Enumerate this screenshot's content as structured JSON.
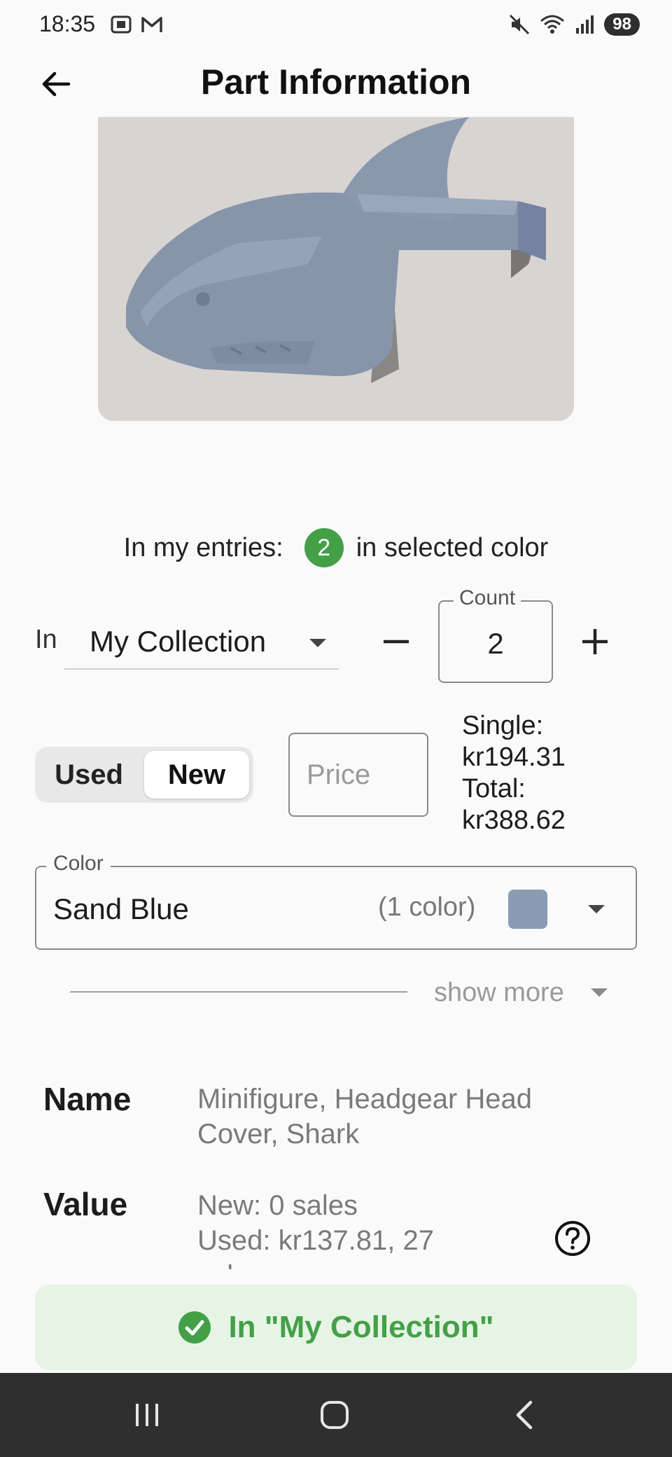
{
  "status_bar": {
    "time": "18:35",
    "battery": "98"
  },
  "app_bar": {
    "title": "Part Information"
  },
  "entries": {
    "prefix": "In my entries:",
    "count": "2",
    "suffix": "in selected color"
  },
  "collection": {
    "in_label": "In",
    "selected": "My Collection",
    "count_label": "Count",
    "count": "2"
  },
  "condition": {
    "used_label": "Used",
    "new_label": "New",
    "selected": "New"
  },
  "price": {
    "placeholder": "Price",
    "single_label": "Single:",
    "single_value": "kr194.31",
    "total_label": "Total:",
    "total_value": "kr388.62"
  },
  "color": {
    "label": "Color",
    "value": "Sand Blue",
    "count_text": "(1 color)",
    "swatch": "#8a9bb4"
  },
  "show_more": {
    "label": "show more"
  },
  "details": {
    "name_label": "Name",
    "name_line1": "Minifigure, Headgear Head",
    "name_line2": "Cover, Shark",
    "value_label": "Value",
    "value_line1": "New: 0 sales",
    "value_line2": "Used: kr137.81, 27",
    "value_line3": "sales"
  },
  "snackbar": {
    "text": "In \"My Collection\""
  },
  "colors": {
    "accent_green": "#43a047",
    "snackbar_bg": "#e6f4e5",
    "nav_bar": "#2f2f2f"
  }
}
